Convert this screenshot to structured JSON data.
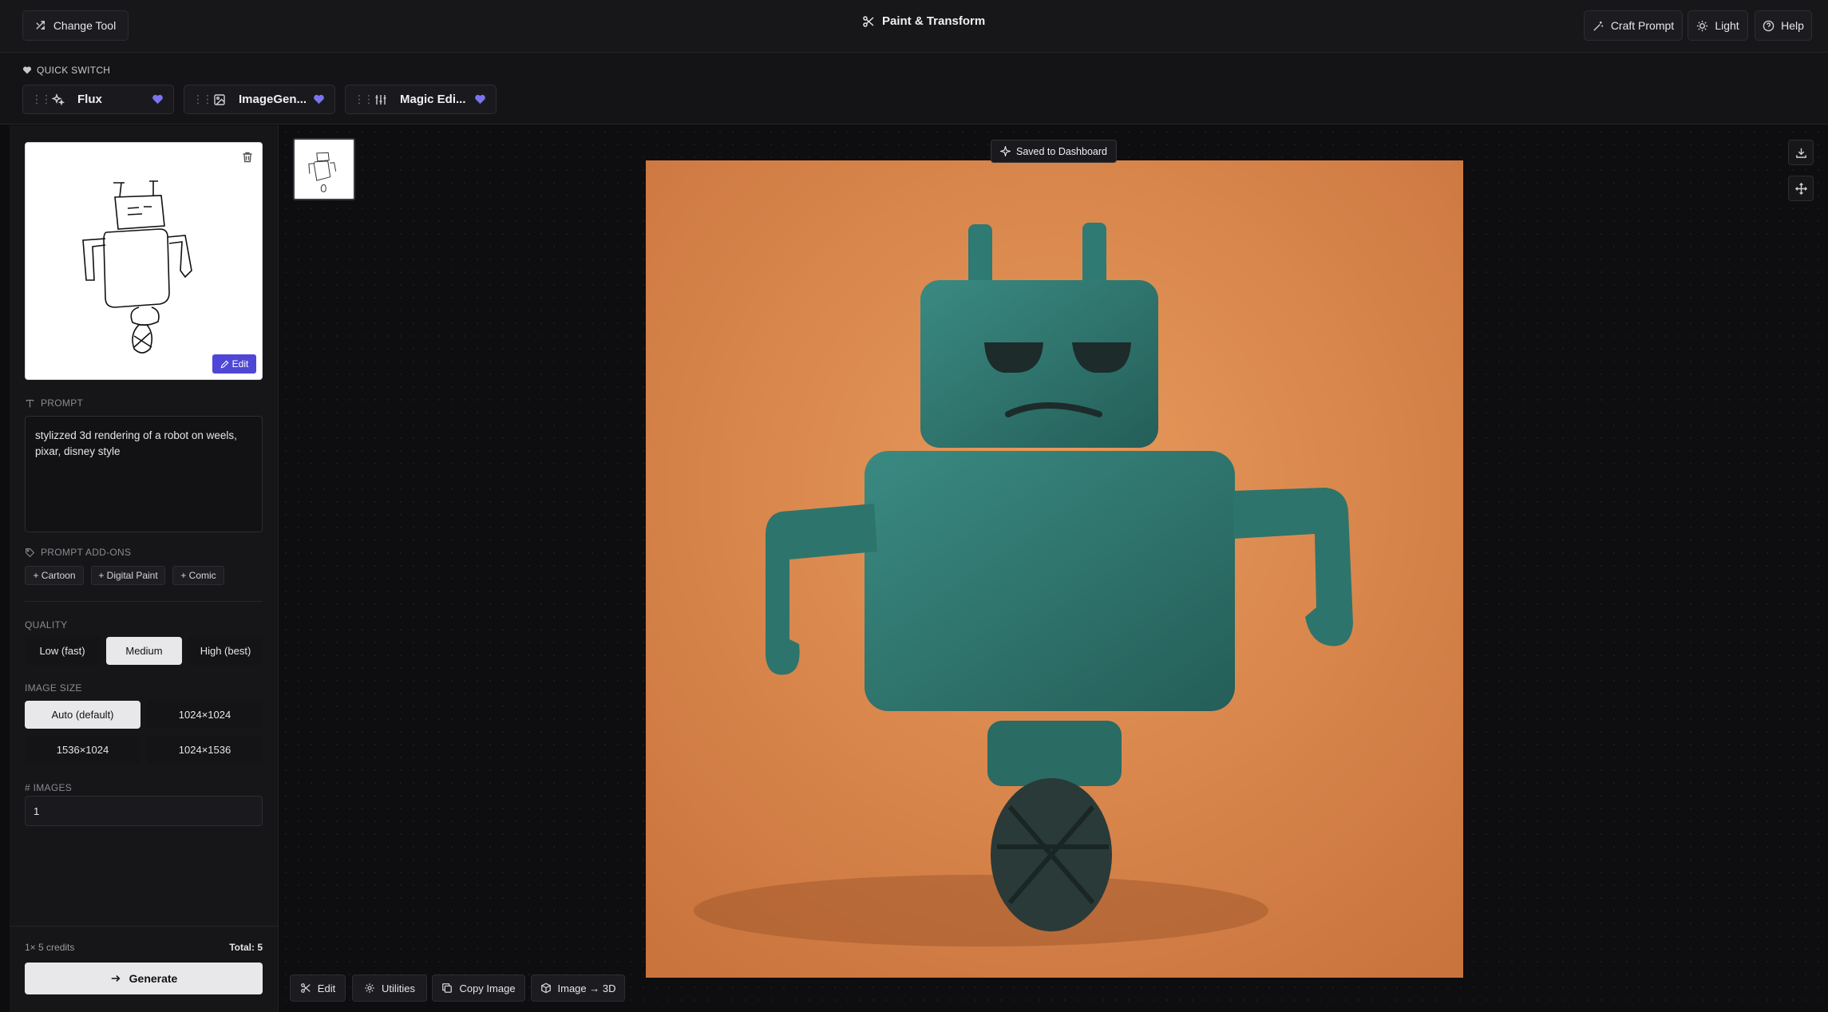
{
  "header": {
    "change_tool": "Change Tool",
    "title": "Paint & Transform",
    "craft_prompt": "Craft Prompt",
    "light": "Light",
    "help": "Help"
  },
  "quick_switch": {
    "label": "QUICK SWITCH",
    "items": [
      {
        "label": "Flux",
        "icon": "sparkles-icon"
      },
      {
        "label": "ImageGen...",
        "icon": "image-icon"
      },
      {
        "label": "Magic Edi...",
        "icon": "sliders-icon"
      }
    ],
    "heart_color": "#7b74f0"
  },
  "sidebar": {
    "edit_label": "Edit",
    "prompt_label": "PROMPT",
    "prompt_value": "stylizzed 3d rendering of a robot on weels, pixar, disney style",
    "addons_label": "PROMPT ADD-ONS",
    "addons": [
      "+ Cartoon",
      "+ Digital Paint",
      "+ Comic"
    ],
    "quality_label": "QUALITY",
    "quality_options": [
      "Low (fast)",
      "Medium",
      "High (best)"
    ],
    "quality_selected": "Medium",
    "size_label": "IMAGE SIZE",
    "size_options": [
      "Auto (default)",
      "1024×1024",
      "1536×1024",
      "1024×1536"
    ],
    "size_selected": "Auto (default)",
    "images_label": "# IMAGES",
    "images_value": "1",
    "credits": "1× 5 credits",
    "total": "Total: 5",
    "generate": "Generate"
  },
  "canvas": {
    "saved_badge": "Saved to Dashboard",
    "actions": [
      "Edit",
      "Utilities",
      "Copy Image",
      "Image → 3D"
    ]
  },
  "colors": {
    "accent": "#4e47d6",
    "background": "#0d0d0f",
    "image_bg": "#e08a4a",
    "robot": "#2f7a72"
  }
}
